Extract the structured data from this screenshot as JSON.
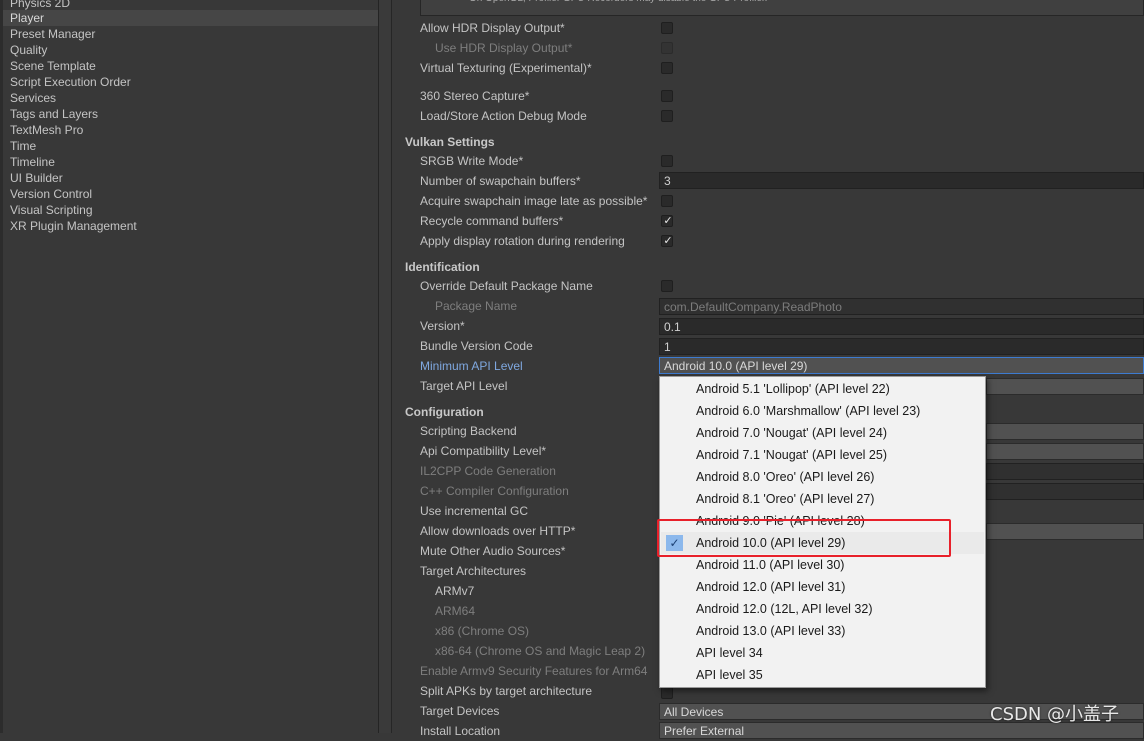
{
  "sidebar": {
    "items": [
      {
        "label": "Physics 2D"
      },
      {
        "label": "Player"
      },
      {
        "label": "Preset Manager"
      },
      {
        "label": "Quality"
      },
      {
        "label": "Scene Template"
      },
      {
        "label": "Script Execution Order"
      },
      {
        "label": "Services"
      },
      {
        "label": "Tags and Layers"
      },
      {
        "label": "TextMesh Pro"
      },
      {
        "label": "Time"
      },
      {
        "label": "Timeline"
      },
      {
        "label": "UI Builder"
      },
      {
        "label": "Version Control"
      },
      {
        "label": "Visual Scripting"
      },
      {
        "label": "XR Plugin Management"
      }
    ],
    "selected": "Player"
  },
  "info_box": {
    "text": "On OpenGL, Profiler GPU Recorders may disable the GPU Profiler."
  },
  "rendering": {
    "allow_hdr": "Allow HDR Display Output*",
    "use_hdr": "Use HDR Display Output*",
    "virtual_texturing": "Virtual Texturing (Experimental)*",
    "stereo_capture": "360 Stereo Capture*",
    "load_store_debug": "Load/Store Action Debug Mode"
  },
  "vulkan": {
    "title": "Vulkan Settings",
    "srgb_write": "SRGB Write Mode*",
    "swapchain_buffers": "Number of swapchain buffers*",
    "swapchain_buffers_value": "3",
    "acquire_late": "Acquire swapchain image late as possible*",
    "recycle_buffers": "Recycle command buffers*",
    "display_rotation": "Apply display rotation during rendering"
  },
  "identification": {
    "title": "Identification",
    "override_package": "Override Default Package Name",
    "package_name": "Package Name",
    "package_name_value": "com.DefaultCompany.ReadPhoto",
    "version": "Version*",
    "version_value": "0.1",
    "bundle_code": "Bundle Version Code",
    "bundle_code_value": "1",
    "min_api": "Minimum API Level",
    "min_api_value": "Android 10.0 (API level 29)",
    "target_api": "Target API Level"
  },
  "configuration": {
    "title": "Configuration",
    "scripting_backend": "Scripting Backend",
    "api_compat": "Api Compatibility Level*",
    "il2cpp_gen": "IL2CPP Code Generation",
    "cpp_compiler": "C++ Compiler Configuration",
    "incremental_gc": "Use incremental GC",
    "http_downloads": "Allow downloads over HTTP*",
    "mute_audio": "Mute Other Audio Sources*",
    "target_arch": "Target Architectures",
    "armv7": "ARMv7",
    "arm64": "ARM64",
    "x86": "x86 (Chrome OS)",
    "x86_64": "x86-64 (Chrome OS and Magic Leap 2)",
    "armv9": "Enable Armv9 Security Features for Arm64",
    "split_apks": "Split APKs by target architecture",
    "target_devices": "Target Devices",
    "target_devices_value": "All Devices",
    "install_location": "Install Location",
    "install_location_value": "Prefer External"
  },
  "api_dropdown": {
    "options": [
      {
        "label": "Android 5.1 'Lollipop' (API level 22)"
      },
      {
        "label": "Android 6.0 'Marshmallow' (API level 23)"
      },
      {
        "label": "Android 7.0 'Nougat' (API level 24)"
      },
      {
        "label": "Android 7.1 'Nougat' (API level 25)"
      },
      {
        "label": "Android 8.0 'Oreo' (API level 26)"
      },
      {
        "label": "Android 8.1 'Oreo' (API level 27)"
      },
      {
        "label": "Android 9.0 'Pie' (API level 28)"
      },
      {
        "label": "Android 10.0 (API level 29)"
      },
      {
        "label": "Android 11.0 (API level 30)"
      },
      {
        "label": "Android 12.0 (API level 31)"
      },
      {
        "label": "Android 12.0 (12L, API level 32)"
      },
      {
        "label": "Android 13.0 (API level 33)"
      },
      {
        "label": "API level 34"
      },
      {
        "label": "API level 35"
      }
    ],
    "checked": "Android 10.0 (API level 29)",
    "check_glyph": "✓"
  },
  "checkbox_glyph": "✓",
  "annotation_color": "#e8202a",
  "watermark": "CSDN @小盖子"
}
